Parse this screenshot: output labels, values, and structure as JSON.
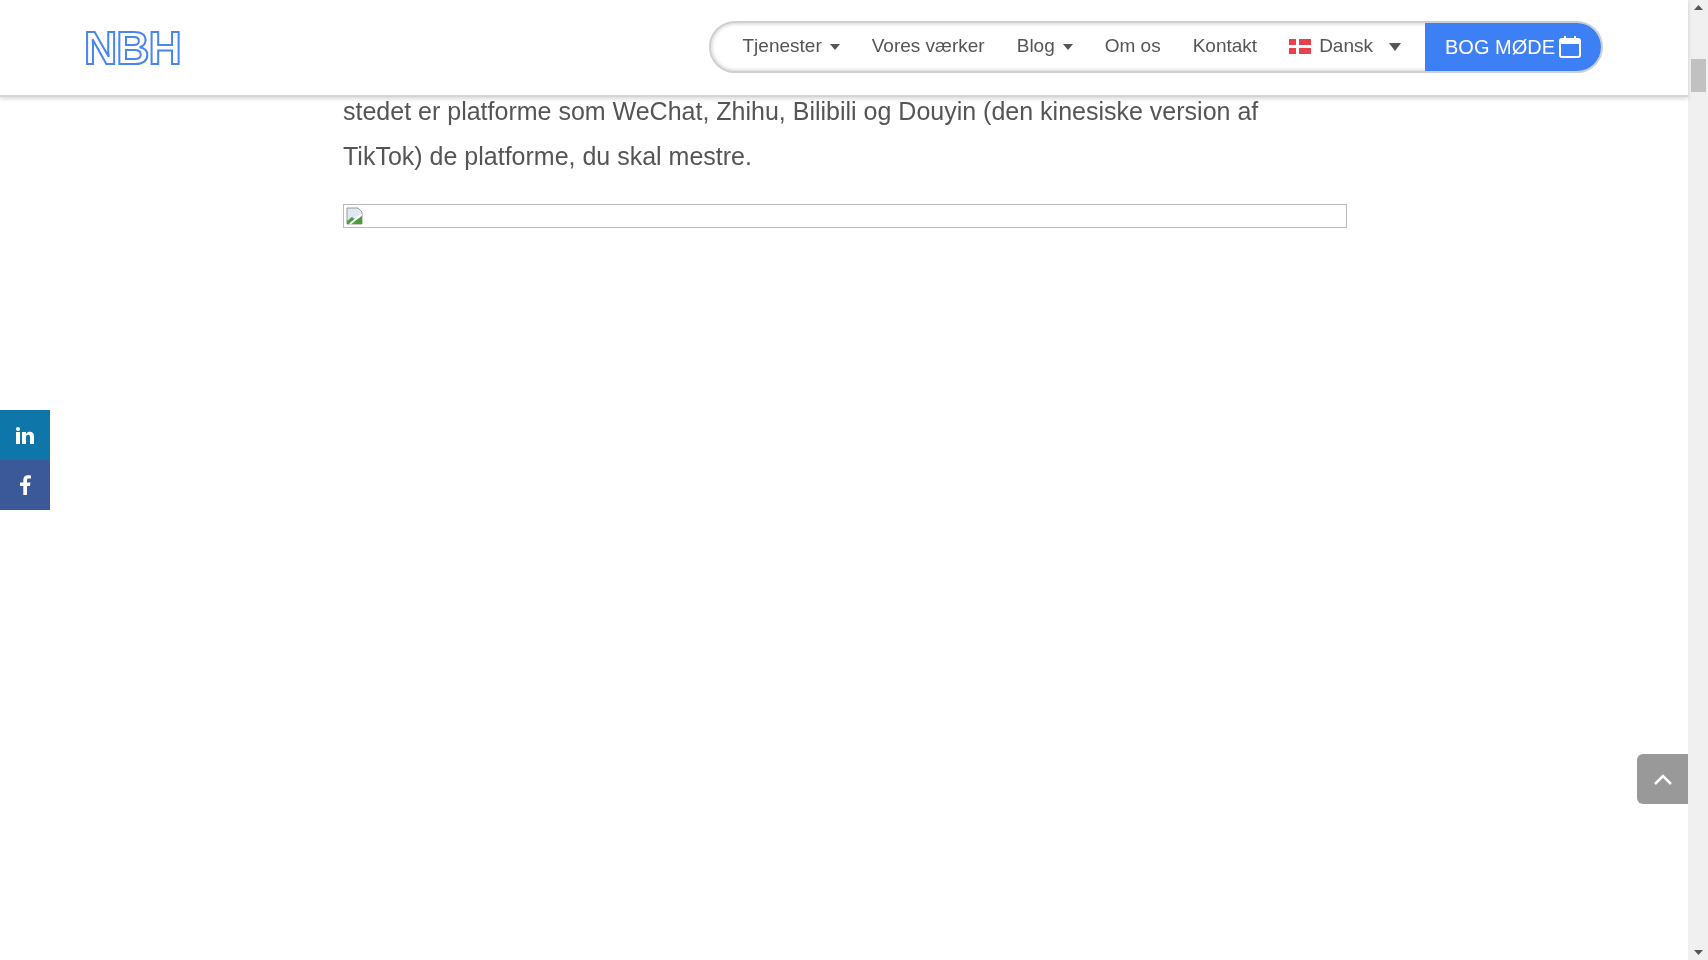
{
  "logo": {
    "text": "NBH"
  },
  "nav": {
    "items": [
      {
        "label": "Tjenester",
        "dropdown": true
      },
      {
        "label": "Vores værker",
        "dropdown": false
      },
      {
        "label": "Blog",
        "dropdown": true
      },
      {
        "label": "Om os",
        "dropdown": false
      },
      {
        "label": "Kontakt",
        "dropdown": false
      }
    ],
    "language": {
      "label": "Dansk"
    },
    "cta": {
      "label": "BOG MØDE"
    }
  },
  "article": {
    "paragraph": "stedet er platforme som WeChat, Zhihu, Bilibili og Douyin (den kinesiske version af TikTok) de platforme, du skal mestre."
  },
  "social": [
    {
      "kind": "linkedin",
      "color": "#0e76a8"
    },
    {
      "kind": "facebook",
      "color": "#3b5998"
    }
  ]
}
